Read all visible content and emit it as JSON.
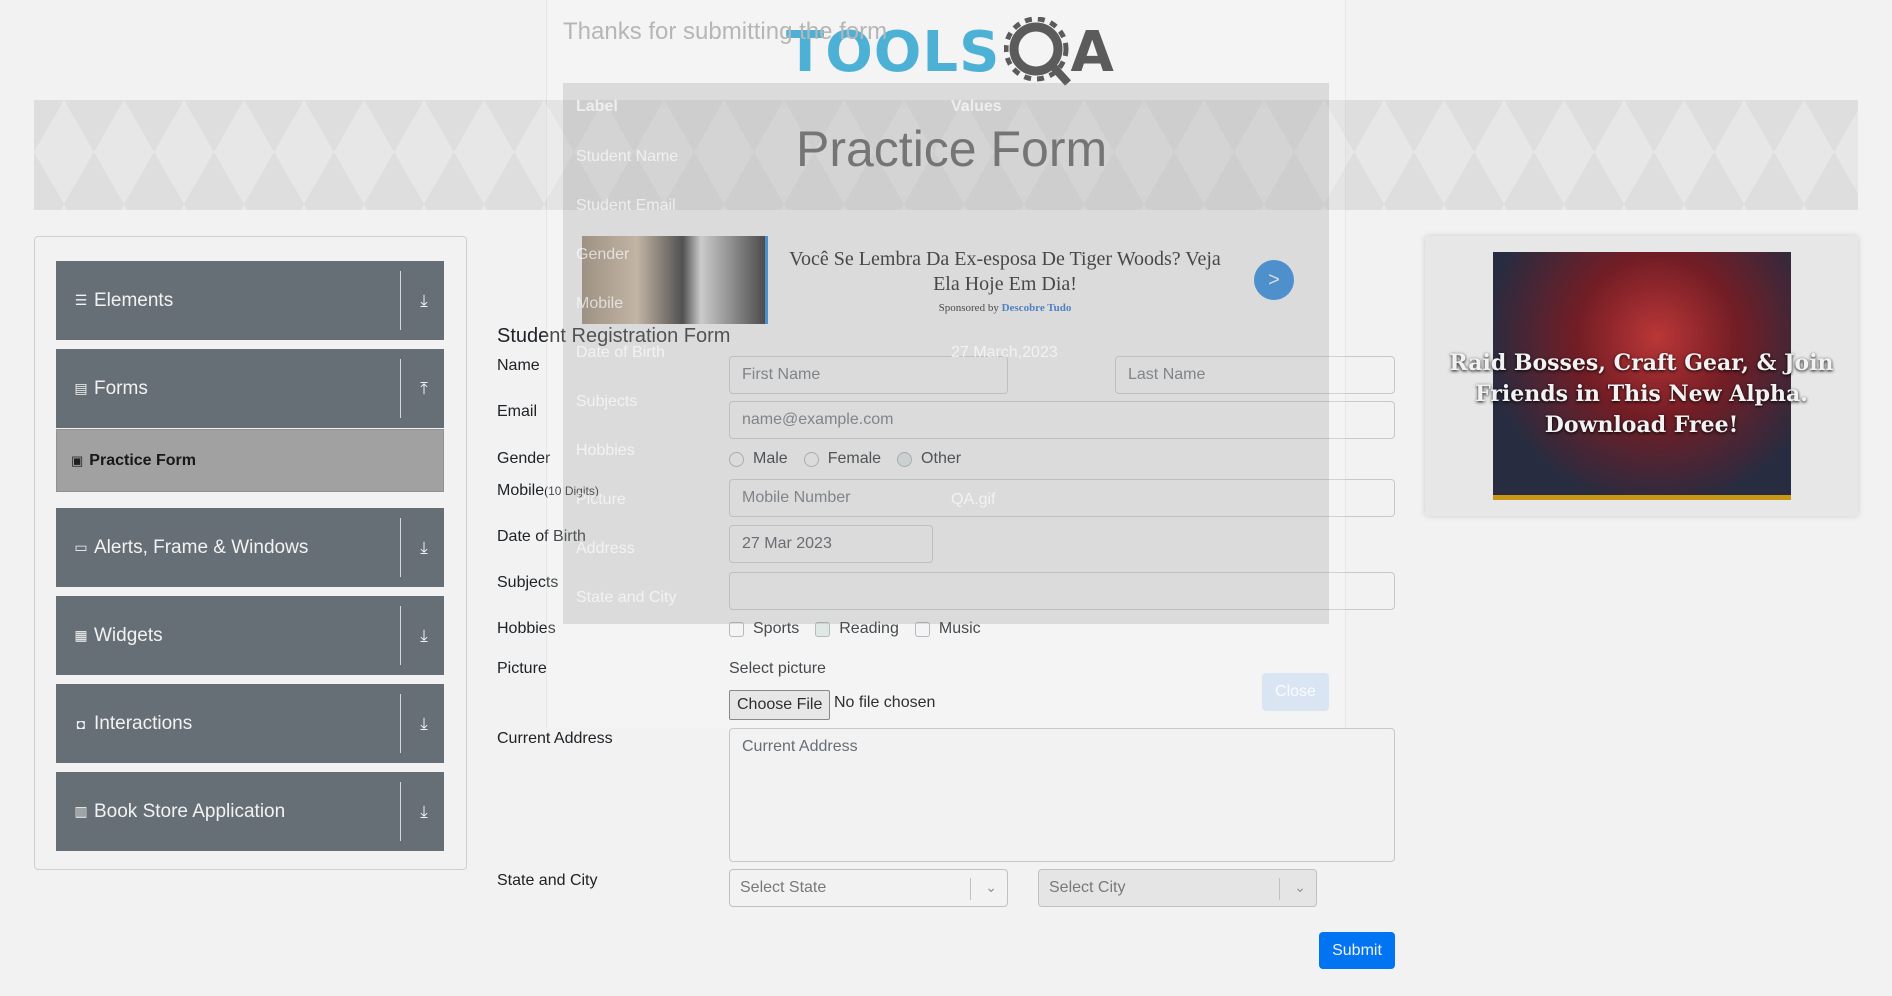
{
  "header": {
    "logo_tools": "TOOLS",
    "logo_qa": "QA",
    "page_title": "Practice Form"
  },
  "sidebar": {
    "groups": [
      {
        "label": "Elements",
        "icon": "list-icon",
        "arrow": "download-icon"
      },
      {
        "label": "Forms",
        "icon": "document-icon",
        "arrow": "upload-icon"
      },
      {
        "label": "Alerts, Frame & Windows",
        "icon": "window-icon",
        "arrow": "download-icon"
      },
      {
        "label": "Widgets",
        "icon": "grid-icon",
        "arrow": "download-icon"
      },
      {
        "label": "Interactions",
        "icon": "interaction-icon",
        "arrow": "download-icon"
      },
      {
        "label": "Book Store Application",
        "icon": "books-icon",
        "arrow": "download-icon"
      }
    ],
    "active_sub_item": "Practice Form"
  },
  "form": {
    "title": "Student Registration Form",
    "labels": {
      "name": "Name",
      "email": "Email",
      "gender": "Gender",
      "mobile": "Mobile",
      "mobile_hint": "(10 Digits)",
      "dob": "Date of Birth",
      "subjects": "Subjects",
      "hobbies": "Hobbies",
      "picture": "Picture",
      "address": "Current Address",
      "state_city": "State and City"
    },
    "first_name_placeholder": "First Name",
    "last_name_placeholder": "Last Name",
    "email_placeholder": "name@example.com",
    "gender_options": [
      "Male",
      "Female",
      "Other"
    ],
    "mobile_placeholder": "Mobile Number",
    "dob_value": "27 Mar 2023",
    "hobbies": [
      "Sports",
      "Reading",
      "Music"
    ],
    "select_picture": "Select picture",
    "choose_file": "Choose File",
    "no_file": "No file chosen",
    "address_placeholder": "Current Address",
    "state_placeholder": "Select State",
    "city_placeholder": "Select City",
    "submit": "Submit"
  },
  "ads": {
    "top_headline": "Você Se Lembra Da Ex-esposa De Tiger Woods? Veja Ela Hoje Em Dia!",
    "top_sponsor_prefix": "Sponsored by",
    "top_sponsor_name": "Descobre Tudo",
    "top_go": ">",
    "right_text": "Raid Bosses, Craft Gear, & Join Friends in This New Alpha. Download Free!"
  },
  "modal": {
    "title": "Thanks for submitting the form",
    "col_label": "Label",
    "col_values": "Values",
    "rows": [
      {
        "label": "Student Name",
        "value": ""
      },
      {
        "label": "Student Email",
        "value": ""
      },
      {
        "label": "Gender",
        "value": ""
      },
      {
        "label": "Mobile",
        "value": ""
      },
      {
        "label": "Date of Birth",
        "value": "27 March,2023"
      },
      {
        "label": "Subjects",
        "value": ""
      },
      {
        "label": "Hobbies",
        "value": ""
      },
      {
        "label": "Picture",
        "value": "QA.gif"
      },
      {
        "label": "Address",
        "value": ""
      },
      {
        "label": "State and City",
        "value": ""
      }
    ],
    "close": "Close"
  }
}
